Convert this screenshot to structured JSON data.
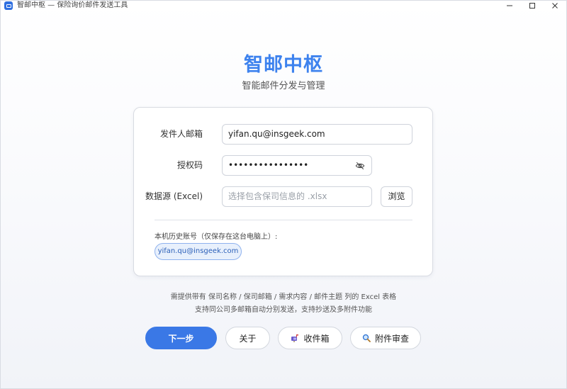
{
  "window": {
    "title": "智邮中枢 — 保险询价邮件发送工具",
    "controls": [
      "minimize",
      "maximize",
      "close"
    ]
  },
  "header": {
    "title": "智邮中枢",
    "subtitle": "智能邮件分发与管理"
  },
  "form": {
    "sender_label": "发件人邮箱",
    "sender_value": "yifan.qu@insgeek.com",
    "auth_label": "授权码",
    "auth_value": "••••••••••••••••",
    "datasource_label": "数据源 (Excel)",
    "datasource_placeholder": "选择包含保司信息的 .xlsx",
    "browse_label": "浏览"
  },
  "history": {
    "label": "本机历史账号（仅保存在这台电脑上）:",
    "accounts": [
      "yifan.qu@insgeek.com"
    ]
  },
  "hints": [
    "需提供带有 保司名称 / 保司邮箱 / 需求内容 / 邮件主题 列的 Excel 表格",
    "支持同公司多邮箱自动分别发送，支持抄送及多附件功能"
  ],
  "actions": {
    "next_label": "下一步",
    "about_label": "关于",
    "inbox_label": "收件箱",
    "inbox_icon": "mailbox-icon",
    "attachment_review_label": "附件审查",
    "attachment_review_icon": "magnifier-icon"
  },
  "colors": {
    "accent": "#3a78e6",
    "title": "#3d82ee",
    "chip_bg": "#e8f0fc",
    "chip_border": "#8fb2ee"
  }
}
